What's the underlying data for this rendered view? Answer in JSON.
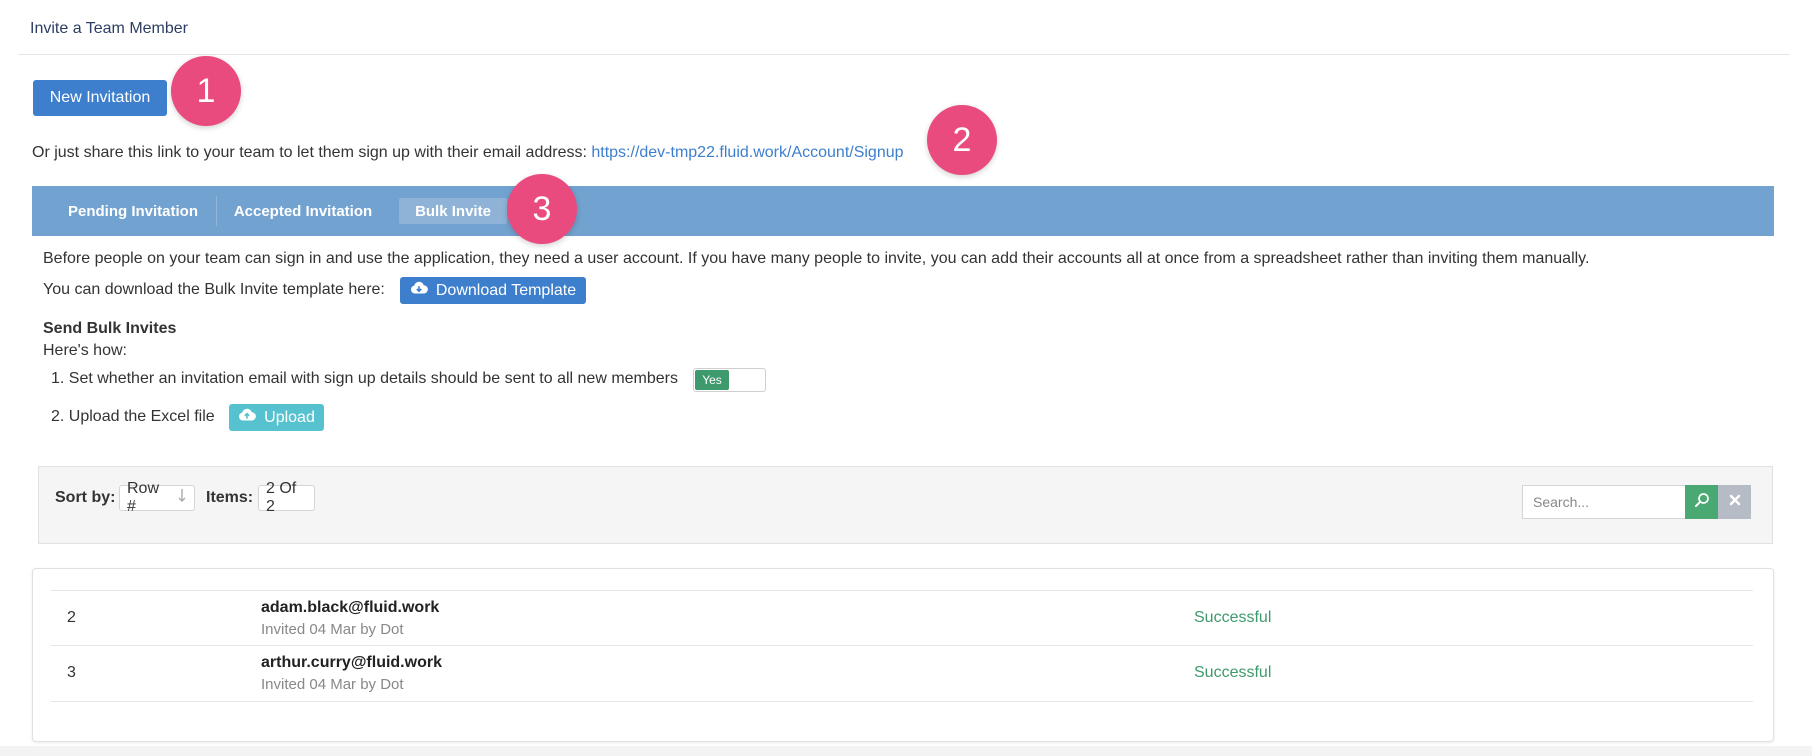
{
  "header": {
    "title": "Invite a Team Member"
  },
  "actions": {
    "new_invitation_label": "New Invitation"
  },
  "share": {
    "text": "Or just share this link to your team to let them sign up with their email address:",
    "link": "https://dev-tmp22.fluid.work/Account/Signup"
  },
  "annotations": [
    "1",
    "2",
    "3"
  ],
  "tabs": [
    {
      "label": "Pending Invitation",
      "active": false
    },
    {
      "label": "Accepted Invitation",
      "active": false
    },
    {
      "label": "Bulk Invite",
      "active": true
    }
  ],
  "bulk": {
    "intro": "Before people on your team can sign in and use the application, they need a user account. If you have many people to invite, you can add their accounts all at once from a spreadsheet rather than inviting them manually.",
    "download_text": "You can download the Bulk Invite template here:",
    "download_label": "Download Template",
    "send_title": "Send Bulk Invites",
    "how_label": "Here's how:",
    "step1": "1. Set whether an invitation email with sign up details should be sent to all new members",
    "toggle_label": "Yes",
    "toggle_on": true,
    "step2": "2. Upload the Excel file",
    "upload_label": "Upload"
  },
  "filter": {
    "sort_label": "Sort by:",
    "sort_value": "Row #",
    "items_label": "Items:",
    "items_value": "2 Of 2",
    "search_placeholder": "Search..."
  },
  "rows": [
    {
      "num": "2",
      "email": "adam.black@fluid.work",
      "meta": "Invited 04 Mar by Dot",
      "status": "Successful"
    },
    {
      "num": "3",
      "email": "arthur.curry@fluid.work",
      "meta": "Invited 04 Mar by Dot",
      "status": "Successful"
    }
  ],
  "colors": {
    "primary": "#3d7fcc",
    "tabbar": "#72a2cf",
    "badge": "#e94b7e",
    "success": "#3e9a6c",
    "upload": "#56c2cf"
  },
  "icons": [
    "cloud-download-icon",
    "cloud-upload-icon",
    "sort-arrow-icon",
    "search-icon",
    "close-icon"
  ]
}
